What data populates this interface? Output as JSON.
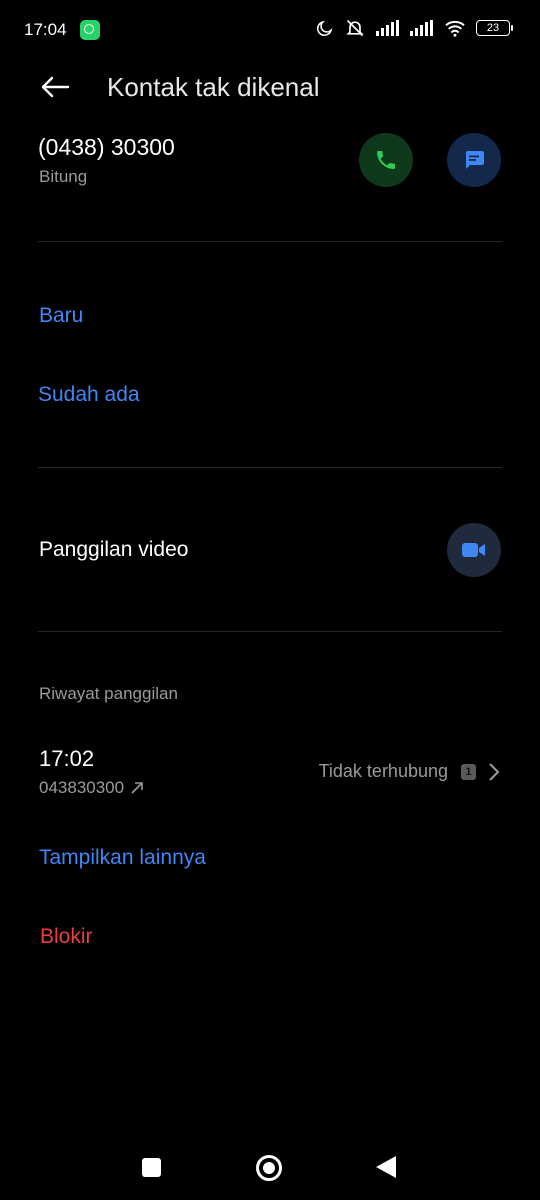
{
  "status_bar": {
    "time": "17:04",
    "battery": "23"
  },
  "header": {
    "title": "Kontak tak dikenal"
  },
  "contact": {
    "number": "(0438) 30300",
    "location": "Bitung"
  },
  "add_contact": {
    "new_label": "Baru",
    "existing_label": "Sudah ada"
  },
  "video": {
    "label": "Panggilan video"
  },
  "call_history": {
    "heading": "Riwayat panggilan",
    "entries": [
      {
        "time": "17:02",
        "number": "043830300",
        "status": "Tidak terhubung",
        "sim": "1"
      }
    ]
  },
  "actions": {
    "show_more": "Tampilkan lainnya",
    "block": "Blokir"
  },
  "colors": {
    "accent_blue": "#3f87f5",
    "call_green": "#2ecc55",
    "block_red": "#e8413c"
  }
}
